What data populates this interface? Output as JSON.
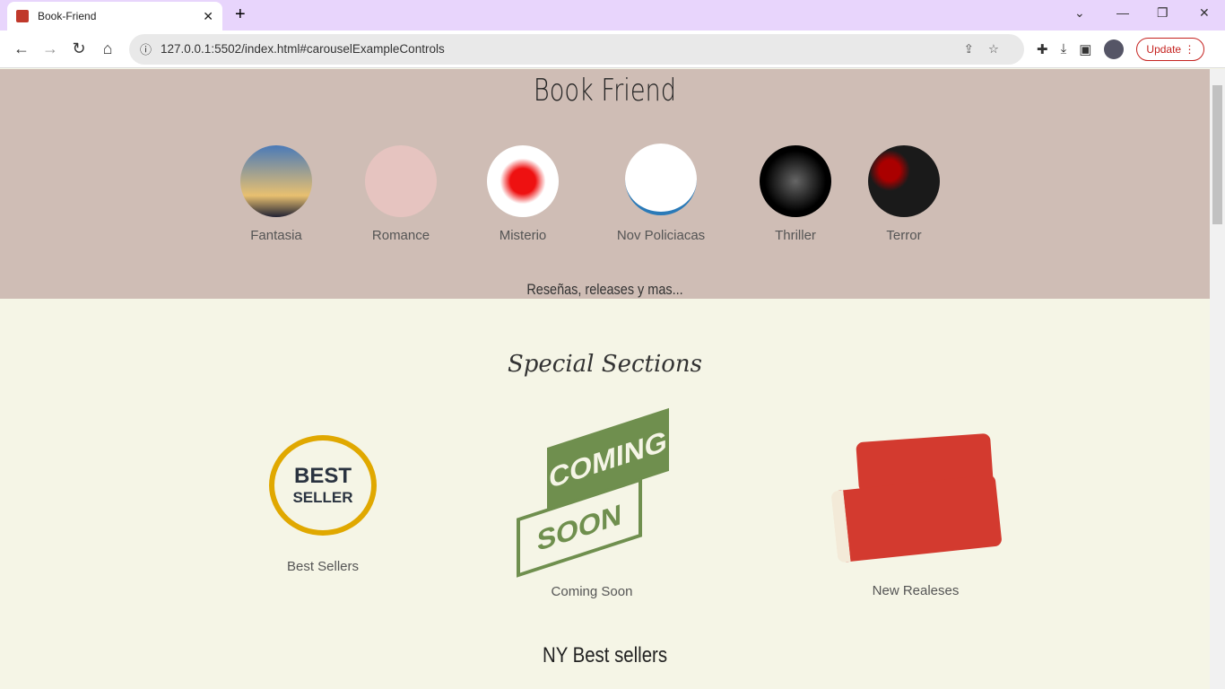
{
  "browser": {
    "tab_title": "Book-Friend",
    "url": "127.0.0.1:5502/index.html#carouselExampleControls",
    "update_label": "Update"
  },
  "header": {
    "title": "Book Friend",
    "subtitle": "Reseñas, releases y mas..."
  },
  "categories": [
    {
      "label": "Fantasia",
      "color": "#3a5a8a"
    },
    {
      "label": "Romance",
      "color": "#e6c4c0"
    },
    {
      "label": "Misterio",
      "color": "#ffffff"
    },
    {
      "label": "Nov Policiacas",
      "color": "#ffffff"
    },
    {
      "label": "Thriller",
      "color": "#0a0a0a"
    },
    {
      "label": "Terror",
      "color": "#1a1a1a"
    }
  ],
  "special": {
    "title": "Special Sections",
    "items": [
      {
        "label": "Best Sellers",
        "badge_line1": "BEST",
        "badge_line2": "SELLER"
      },
      {
        "label": "Coming Soon",
        "badge_line1": "COMING",
        "badge_line2": "SOON"
      },
      {
        "label": "New Realeses"
      }
    ]
  },
  "ny": {
    "title": "NY Best sellers"
  }
}
